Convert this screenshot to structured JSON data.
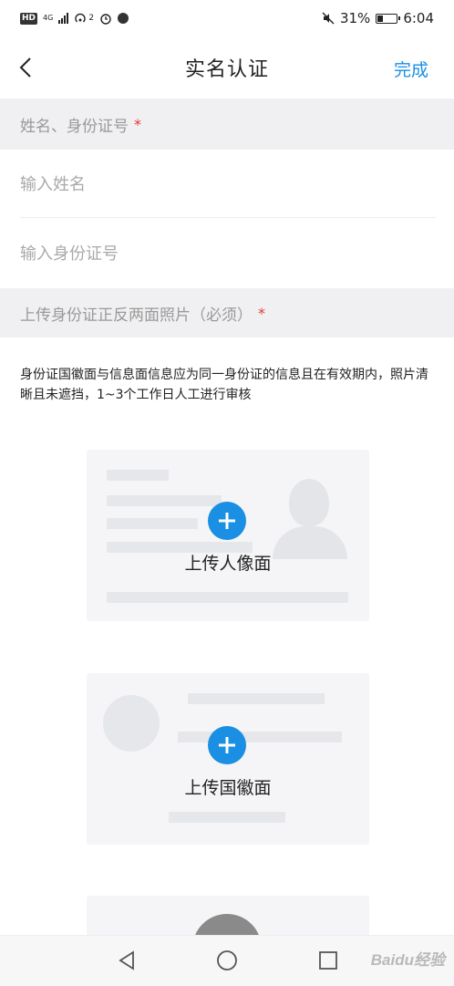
{
  "status_bar": {
    "hd_badge": "HD",
    "network_tag": "4G",
    "superscript_count": "2",
    "battery_percent": "31%",
    "time": "6:04",
    "icons": [
      "signal-icon",
      "hotspot-icon",
      "alarm-icon",
      "notification-icon",
      "mute-icon",
      "battery-icon"
    ]
  },
  "nav": {
    "back_icon": "chevron-left-icon",
    "title": "实名认证",
    "done_label": "完成",
    "accent_color": "#1a8fe3"
  },
  "form": {
    "section_name_id": {
      "label": "姓名、身份证号",
      "required_mark": "*"
    },
    "name_input": {
      "placeholder": "输入姓名",
      "value": ""
    },
    "id_input": {
      "placeholder": "输入身份证号",
      "value": ""
    },
    "section_photos": {
      "label": "上传身份证正反两面照片（必须）",
      "required_mark": "*"
    },
    "hint": "身份证国徽面与信息面信息应为同一身份证的信息且在有效期内，照片清晰且未遮挡，1~3个工作日人工进行审核"
  },
  "upload_cards": [
    {
      "label": "上传人像面",
      "icon": "plus-icon"
    },
    {
      "label": "上传国徽面",
      "icon": "plus-icon"
    }
  ],
  "system_nav": {
    "icons": [
      "back-triangle-icon",
      "home-circle-icon",
      "recents-square-icon"
    ],
    "watermark": "Baidu经验"
  }
}
